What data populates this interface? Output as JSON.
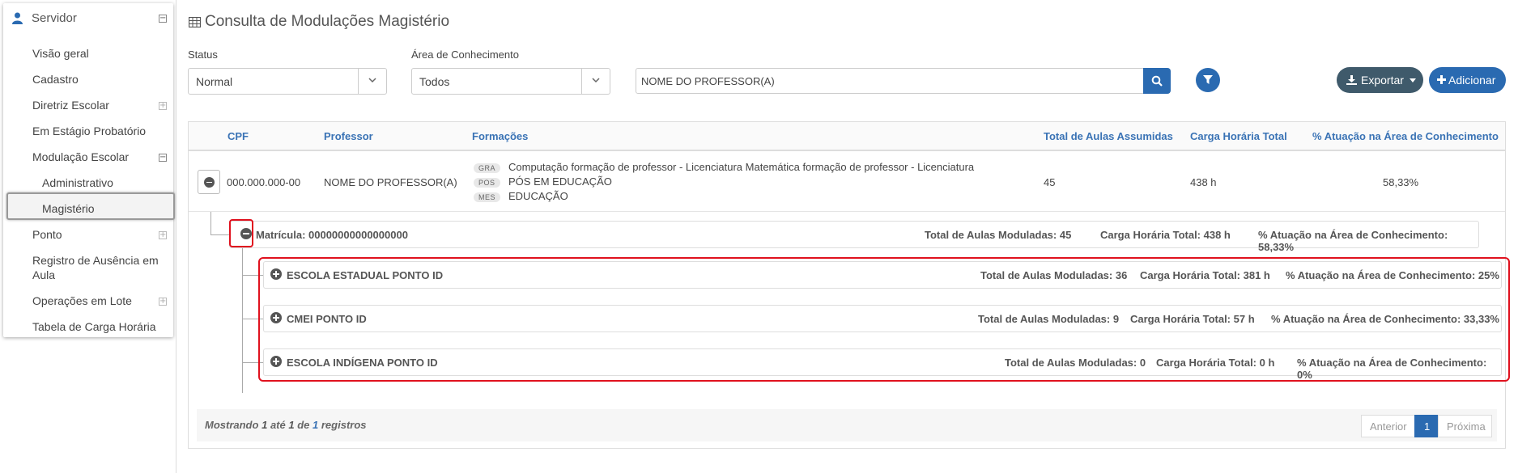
{
  "sidebar": {
    "header": "Servidor",
    "items": [
      {
        "label": "Visão geral"
      },
      {
        "label": "Cadastro"
      },
      {
        "label": "Diretriz Escolar"
      },
      {
        "label": "Em Estágio Probatório"
      },
      {
        "label": "Modulação Escolar"
      },
      {
        "label": "Administrativo"
      },
      {
        "label": "Magistério"
      },
      {
        "label": "Ponto"
      },
      {
        "label": "Registro de Ausência em"
      },
      {
        "label": "Aula"
      },
      {
        "label": "Operações em Lote"
      },
      {
        "label": "Tabela de Carga Horária"
      }
    ],
    "active": "Magistério"
  },
  "page": {
    "title": "Consulta de Modulações Magistério"
  },
  "filters": {
    "status_label": "Status",
    "status_value": "Normal",
    "area_label": "Área de Conhecimento",
    "area_value": "Todos",
    "search_value": "NOME DO PROFESSOR(A)"
  },
  "toolbar": {
    "export_label": "Exportar",
    "add_label": "Adicionar"
  },
  "table": {
    "headers": [
      "CPF",
      "Professor",
      "Formações",
      "Total de Aulas Assumidas",
      "Carga Horária Total",
      "% Atuação na Área de Conhecimento"
    ],
    "row": {
      "cpf": "000.000.000-00",
      "professor": "NOME DO PROFESSOR(A)",
      "formacoes": [
        {
          "badge": "GRA",
          "text": "Computação formação de professor - Licenciatura Matemática formação de professor - Licenciatura"
        },
        {
          "badge": "POS",
          "text": "PÓS EM EDUCAÇÃO"
        },
        {
          "badge": "MES",
          "text": "EDUCAÇÃO"
        }
      ],
      "total_aulas": "45",
      "carga": "438 h",
      "atuacao": "58,33%"
    },
    "matricula": {
      "label": "Matrícula: 00000000000000000",
      "aulas": "Total de Aulas Moduladas: 45",
      "carga": "Carga Horária Total: 438 h",
      "atuacao": "% Atuação na Área de Conhecimento: 58,33%"
    },
    "schools": [
      {
        "name": "ESCOLA ESTADUAL PONTO ID",
        "aulas": "Total de Aulas Moduladas: 36",
        "carga": "Carga Horária Total: 381 h",
        "atuacao": "% Atuação na Área de Conhecimento: 25%"
      },
      {
        "name": "CMEI PONTO ID",
        "aulas": "Total de Aulas Moduladas: 9",
        "carga": "Carga Horária Total: 57 h",
        "atuacao": "% Atuação na Área de Conhecimento: 33,33%"
      },
      {
        "name": "ESCOLA INDÍGENA PONTO ID",
        "aulas": "Total de Aulas Moduladas: 0",
        "carga": "Carga Horária Total: 0 h",
        "atuacao": "% Atuação na Área de Conhecimento: 0%"
      }
    ]
  },
  "footer": {
    "mostrando": "Mostrando",
    "de_inicio": "1",
    "ate": "até",
    "ate_num": "1",
    "de": "de",
    "total": "1",
    "registros": "registros",
    "prev": "Anterior",
    "page": "1",
    "next": "Próxima"
  },
  "colors": {
    "primary": "#2a6ab1",
    "export": "#3f5a6b",
    "highlight": "#e0111e",
    "header_text": "#3a73b5"
  }
}
